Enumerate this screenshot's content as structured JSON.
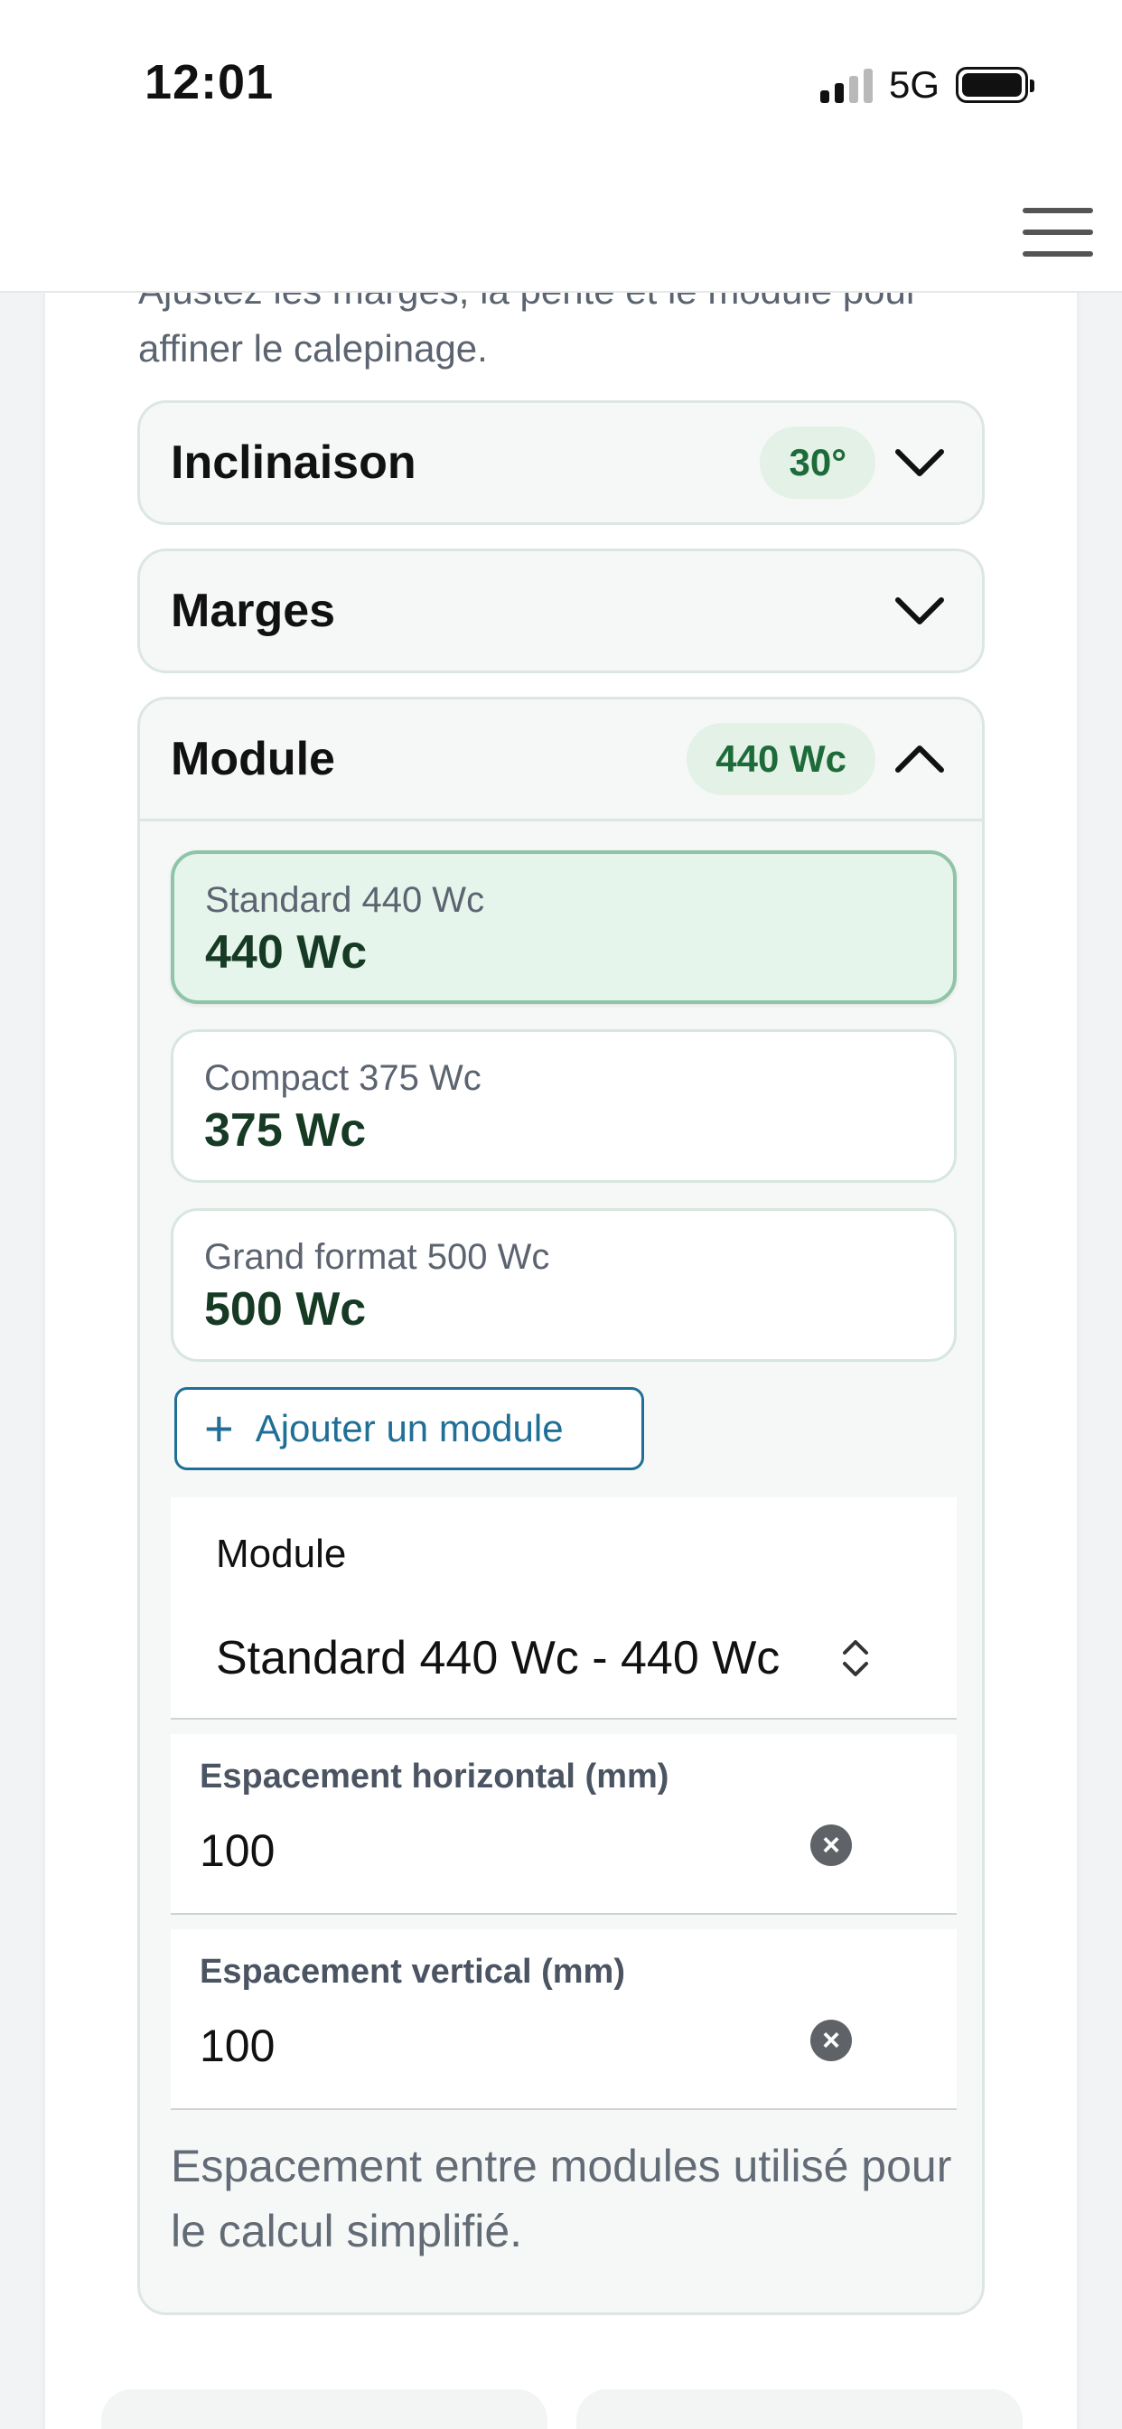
{
  "status_bar": {
    "time": "12:01",
    "network": "5G"
  },
  "intro_text": "Ajustez les marges, la pente et le module pour affiner le calepinage.",
  "sections": {
    "inclinaison": {
      "title": "Inclinaison",
      "badge": "30°"
    },
    "marges": {
      "title": "Marges"
    },
    "module": {
      "title": "Module",
      "badge": "440 Wc",
      "options": [
        {
          "name": "Standard 440 Wc",
          "power": "440 Wc",
          "selected": true
        },
        {
          "name": "Compact 375 Wc",
          "power": "375 Wc",
          "selected": false
        },
        {
          "name": "Grand format 500 Wc",
          "power": "500 Wc",
          "selected": false
        }
      ],
      "add_button": "Ajouter un module",
      "select": {
        "label": "Module",
        "value": "Standard 440 Wc - 440 Wc"
      },
      "horizontal_spacing": {
        "label": "Espacement horizontal (mm)",
        "value": "100"
      },
      "vertical_spacing": {
        "label": "Espacement vertical (mm)",
        "value": "100"
      },
      "help_text": "Espacement entre modules utilisé pour le calcul simplifié."
    }
  },
  "colors": {
    "accent_green": "#1e6b3a",
    "accent_blue": "#1f6f96",
    "selected_bg": "#e6f5eb"
  }
}
